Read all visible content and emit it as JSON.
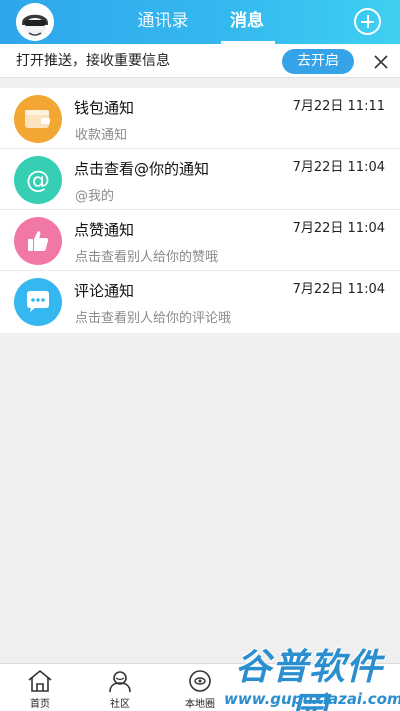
{
  "header": {
    "tabs": [
      {
        "label": "通讯录",
        "active": false
      },
      {
        "label": "消息",
        "active": true
      }
    ],
    "accent_color": "#34b0ee"
  },
  "push_notice": {
    "text": "打开推送，接收重要信息",
    "button_label": "去开启"
  },
  "messages": [
    {
      "title": "钱包通知",
      "subtitle": "收款通知",
      "time": "7月22日 11:11",
      "icon": "wallet-icon",
      "color": "#f2a735"
    },
    {
      "title": "点击查看@你的通知",
      "subtitle": "@我的",
      "time": "7月22日 11:04",
      "icon": "at-icon",
      "color": "#36cfb4"
    },
    {
      "title": "点赞通知",
      "subtitle": "点击查看别人给你的赞哦",
      "time": "7月22日 11:04",
      "icon": "thumbs-up-icon",
      "color": "#f077a6"
    },
    {
      "title": "评论通知",
      "subtitle": "点击查看别人给你的评论哦",
      "time": "7月22日 11:04",
      "icon": "comment-icon",
      "color": "#35b7ef"
    }
  ],
  "bottom_nav": [
    {
      "label": "首页",
      "icon": "home-icon"
    },
    {
      "label": "社区",
      "icon": "community-icon"
    },
    {
      "label": "本地圈",
      "icon": "local-circle-icon"
    }
  ],
  "watermark": {
    "title": "谷普软件园",
    "url": "www.gupuxiazai.com"
  }
}
